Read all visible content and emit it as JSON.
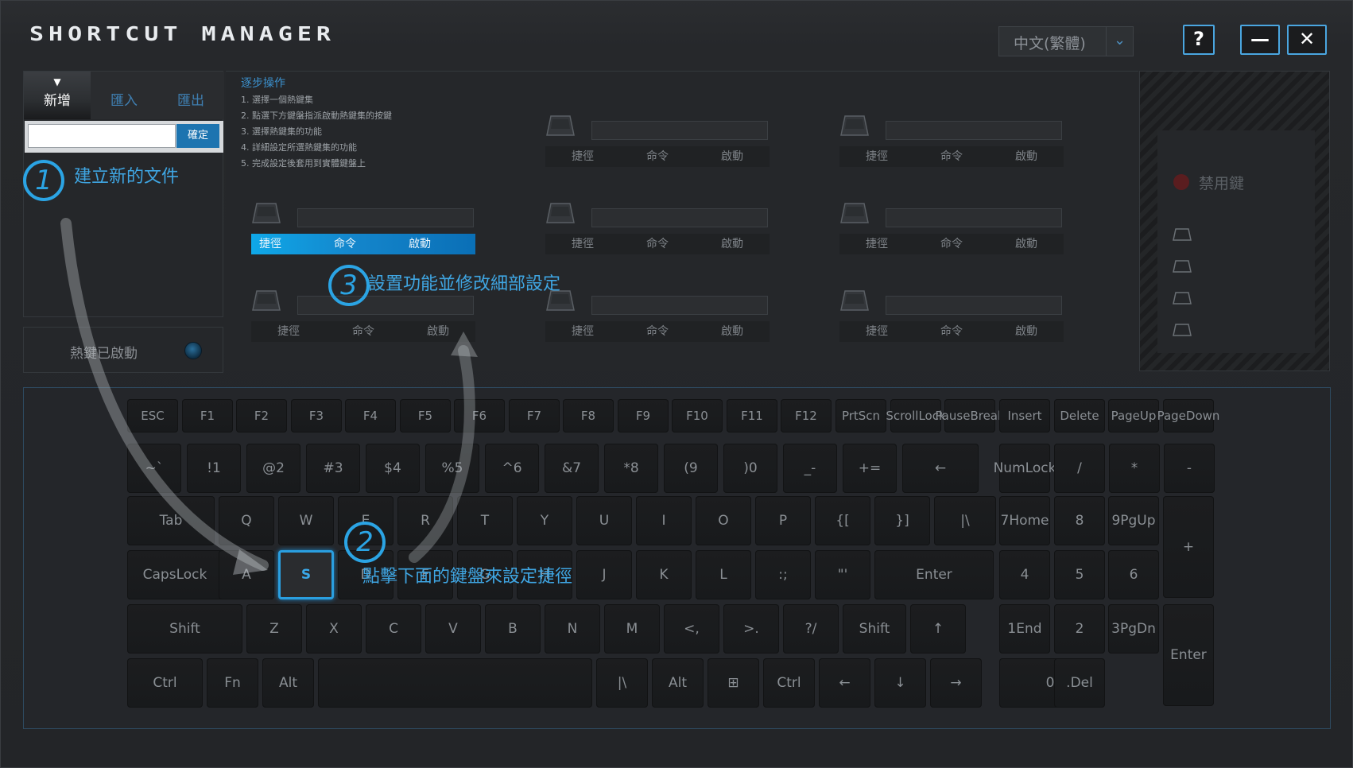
{
  "app": {
    "title": "SHORTCUT MANAGER",
    "language": "中文(繁體)",
    "help_label": "?",
    "minimize_label": "—",
    "close_label": "✕"
  },
  "file_panel": {
    "tabs": [
      "新增",
      "匯入",
      "匯出"
    ],
    "active_tab": "新增",
    "new_name_value": "",
    "confirm_label": "確定",
    "hotkey_status": "熱鍵已啟動"
  },
  "steps": {
    "title": "逐步操作",
    "items": [
      "1. 選擇一個熱鍵集",
      "2. 點選下方鍵盤指派啟動熱鍵集的按鍵",
      "3. 選擇熱鍵集的功能",
      "4. 詳細設定所選熱鍵集的功能",
      "5. 完成設定後套用到實體鍵盤上"
    ]
  },
  "slot_tabs": [
    "捷徑",
    "命令",
    "啟動"
  ],
  "disabled_keys": {
    "label": "禁用鍵"
  },
  "annotations": {
    "step1": {
      "num": "1",
      "text": "建立新的文件"
    },
    "step2": {
      "num": "2",
      "text": "點擊下面的鍵盤來設定捷徑"
    },
    "step3": {
      "num": "3",
      "text": "設置功能並修改細部設定"
    }
  },
  "keyboard": {
    "row_f": [
      "ESC",
      "F1",
      "F2",
      "F3",
      "F4",
      "F5",
      "F6",
      "F7",
      "F8",
      "F9",
      "F10",
      "F11",
      "F12",
      "PrtScn",
      "Scroll Lock",
      "Pause Break",
      "Insert",
      "Delete",
      "Page Up",
      "Page Down"
    ],
    "row_num": [
      [
        "~",
        "`"
      ],
      [
        "!",
        "1"
      ],
      [
        "@",
        "2"
      ],
      [
        "#",
        "3"
      ],
      [
        "$",
        "4"
      ],
      [
        "%",
        "5"
      ],
      [
        "^",
        "6"
      ],
      [
        "&",
        "7"
      ],
      [
        "*",
        "8"
      ],
      [
        "(",
        "9"
      ],
      [
        ")",
        "0"
      ],
      [
        "_",
        "-"
      ],
      [
        "+",
        "="
      ],
      [
        "←",
        ""
      ],
      [
        "Num",
        "Lock"
      ],
      [
        "/",
        ""
      ],
      [
        "*",
        ""
      ],
      [
        "-",
        ""
      ]
    ],
    "row_q": [
      "Tab",
      "Q",
      "W",
      "E",
      "R",
      "T",
      "Y",
      "U",
      "I",
      "O",
      "P",
      "{ [",
      "} ]",
      "| \\",
      "7 Home",
      "8",
      "9 PgUp",
      "+"
    ],
    "row_a": [
      "Caps Lock",
      "A",
      "S",
      "D",
      "F",
      "G",
      "H",
      "J",
      "K",
      "L",
      ": ;",
      "\" '",
      "Enter",
      "4",
      "5",
      "6"
    ],
    "row_z": [
      "Shift",
      "Z",
      "X",
      "C",
      "V",
      "B",
      "N",
      "M",
      "< ,",
      "> .",
      "? /",
      "Shift",
      "↑",
      "1 End",
      "2",
      "3 PgDn",
      "Enter"
    ],
    "row_ctrl": [
      "Ctrl",
      "Fn",
      "Alt",
      "",
      "| \\",
      "Alt",
      "⊞",
      "Ctrl",
      "←",
      "↓",
      "→",
      "0",
      ". Del"
    ]
  }
}
